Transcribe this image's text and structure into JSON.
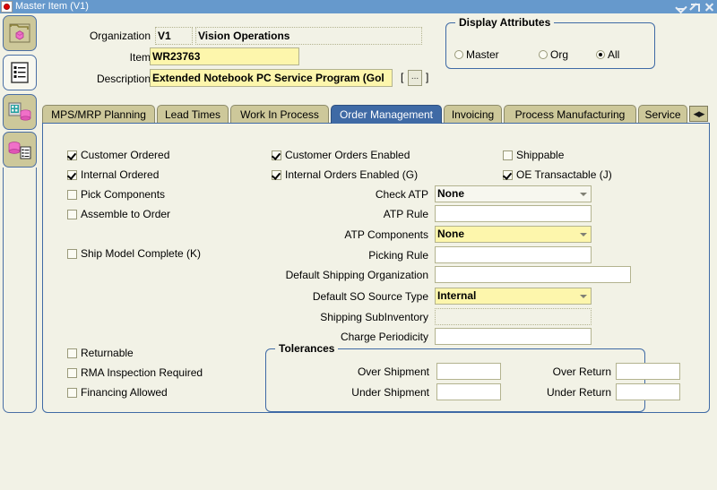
{
  "window": {
    "title": "Master Item (V1)",
    "icon": "oracle-logo-icon",
    "controls": {
      "minimize": "Minimize",
      "restore": "Restore",
      "close": "Close"
    }
  },
  "rail": {
    "items": [
      {
        "name": "folder-item-icon",
        "label": "Folder"
      },
      {
        "name": "list-document-icon",
        "label": "List"
      },
      {
        "name": "organization-item-icon",
        "label": "Organization Item"
      },
      {
        "name": "item-list-icon",
        "label": "Item List"
      }
    ]
  },
  "header": {
    "organization_label": "Organization",
    "organization_code": "V1",
    "organization_name": "Vision Operations",
    "item_label": "Item",
    "item_value": "WR23763",
    "description_label": "Description",
    "description_value": "Extended Notebook PC Service Program (Gol",
    "desc_bracket_open": "[",
    "desc_bracket_close": "]",
    "desc_button_label": "...",
    "display_attributes": {
      "title": "Display Attributes",
      "options": [
        {
          "label": "Master",
          "accesskey": "M",
          "selected": false
        },
        {
          "label": "Org",
          "accesskey": "O",
          "selected": false
        },
        {
          "label": "All",
          "accesskey": "A",
          "selected": true
        }
      ]
    }
  },
  "tabs": {
    "items": [
      {
        "label": "MPS/MRP Planning",
        "active": false
      },
      {
        "label": "Lead Times",
        "active": false
      },
      {
        "label": "Work In Process",
        "active": false
      },
      {
        "label": "Order Management",
        "active": true
      },
      {
        "label": "Invoicing",
        "active": false
      },
      {
        "label": "Process Manufacturing",
        "active": false
      },
      {
        "label": "Service",
        "active": false
      }
    ],
    "nav_arrows": "◀▶"
  },
  "order_management": {
    "left_checkboxes": [
      {
        "label": "Customer Ordered",
        "accesskey": "C",
        "checked": true
      },
      {
        "label": "Internal Ordered",
        "accesskey": "r",
        "checked": true
      },
      {
        "label": "Pick Components",
        "accesskey": "P",
        "checked": false
      },
      {
        "label": "Assemble to Order",
        "accesskey": "m",
        "checked": false
      },
      {
        "label": "Ship Model Complete (K)",
        "accesskey": "K",
        "checked": false
      }
    ],
    "mid_checkboxes": [
      {
        "label": "Customer Orders Enabled",
        "accesskey": "d",
        "checked": true
      },
      {
        "label": "Internal Orders Enabled (G)",
        "accesskey": "G",
        "checked": true
      }
    ],
    "right_checkboxes": [
      {
        "label": "Shippable",
        "checked": false
      },
      {
        "label": "OE Transactable (J)",
        "accesskey": "J",
        "checked": true
      }
    ],
    "bottom_checkboxes": [
      {
        "label": "Returnable",
        "accesskey": "u",
        "checked": false
      },
      {
        "label": "RMA Inspection Required",
        "checked": false
      },
      {
        "label": "Financing Allowed",
        "checked": false
      }
    ],
    "fields": [
      {
        "label": "Check ATP",
        "value": "None",
        "type": "combo",
        "style": "plain"
      },
      {
        "label": "ATP Rule",
        "value": "",
        "type": "text",
        "style": "white"
      },
      {
        "label": "ATP Components",
        "value": "None",
        "type": "combo",
        "style": "yellow"
      },
      {
        "label": "Picking Rule",
        "value": "",
        "type": "text",
        "style": "white"
      },
      {
        "label": "Default Shipping Organization",
        "value": "",
        "type": "text",
        "style": "white"
      },
      {
        "label": "Default SO Source Type",
        "value": "Internal",
        "type": "combo",
        "style": "yellow"
      },
      {
        "label": "Shipping SubInventory",
        "value": "",
        "type": "text",
        "style": "readonly"
      },
      {
        "label": "Charge Periodicity",
        "value": "",
        "type": "text",
        "style": "white"
      }
    ],
    "tolerances": {
      "title": "Tolerances",
      "rows": [
        {
          "left_label": "Over Shipment",
          "left_value": "",
          "right_label": "Over Return",
          "right_value": ""
        },
        {
          "left_label": "Under Shipment",
          "left_value": "",
          "right_label": "Under Return",
          "right_value": ""
        }
      ]
    }
  },
  "colors": {
    "titlebar": "#6699cc",
    "window_bg": "#f2f2e6",
    "tab_inactive": "#cdc89a",
    "tab_active": "#3f6aa5",
    "required_field": "#fdf6ac",
    "group_border": "#3f6aa5"
  }
}
